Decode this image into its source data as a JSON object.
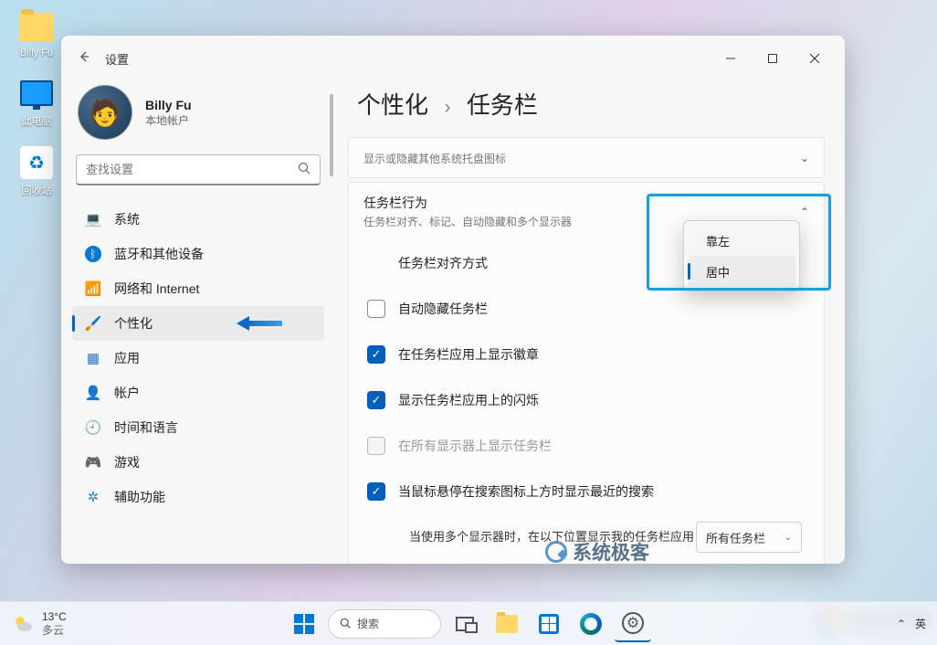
{
  "desktop": [
    {
      "name": "user-folder",
      "label": "Billy Fu"
    },
    {
      "name": "this-pc",
      "label": "此电脑"
    },
    {
      "name": "recycle-bin",
      "label": "回收站"
    }
  ],
  "window": {
    "title": "设置",
    "profile": {
      "name": "Billy Fu",
      "sub": "本地帐户"
    },
    "search_placeholder": "查找设置",
    "nav": [
      {
        "icon": "💻",
        "color": "#0078d4",
        "label": "系统",
        "name": "nav-system"
      },
      {
        "icon": "ᛒ",
        "color": "#0078d4",
        "label": "蓝牙和其他设备",
        "name": "nav-bluetooth",
        "iconbg": "#0078d4"
      },
      {
        "icon": "📶",
        "color": "#0aa0d8",
        "label": "网络和 Internet",
        "name": "nav-network"
      },
      {
        "icon": "🖌️",
        "color": "#d07030",
        "label": "个性化",
        "name": "nav-personalization",
        "active": true
      },
      {
        "icon": "▦",
        "color": "#3070c0",
        "label": "应用",
        "name": "nav-apps"
      },
      {
        "icon": "👤",
        "color": "#5a7a8a",
        "label": "帐户",
        "name": "nav-accounts"
      },
      {
        "icon": "🕘",
        "color": "#2090c0",
        "label": "时间和语言",
        "name": "nav-time-language"
      },
      {
        "icon": "🎮",
        "color": "#6a7a8a",
        "label": "游戏",
        "name": "nav-gaming"
      },
      {
        "icon": "✲",
        "color": "#1a90c8",
        "label": "辅助功能",
        "name": "nav-accessibility"
      }
    ],
    "breadcrumb": {
      "parent": "个性化",
      "current": "任务栏"
    },
    "tray_section": {
      "title": "",
      "sub": "显示或隐藏其他系统托盘图标"
    },
    "behavior_section": {
      "title": "任务栏行为",
      "sub": "任务栏对齐、标记、自动隐藏和多个显示器"
    },
    "align_row": {
      "label": "任务栏对齐方式",
      "options": [
        "靠左",
        "居中"
      ],
      "selected": "居中"
    },
    "rows": [
      {
        "type": "checkbox",
        "checked": false,
        "label": "自动隐藏任务栏",
        "name": "opt-auto-hide"
      },
      {
        "type": "checkbox",
        "checked": true,
        "label": "在任务栏应用上显示徽章",
        "name": "opt-badges"
      },
      {
        "type": "checkbox",
        "checked": true,
        "label": "显示任务栏应用上的闪烁",
        "name": "opt-flashing"
      },
      {
        "type": "checkbox",
        "checked": false,
        "disabled": true,
        "label": "在所有显示器上显示任务栏",
        "name": "opt-all-displays"
      },
      {
        "type": "checkbox",
        "checked": true,
        "label": "当鼠标悬停在搜索图标上方时显示最近的搜索",
        "name": "opt-recent-search"
      }
    ],
    "multi_display_row": {
      "label": "当使用多个显示器时，在以下位置显示我的任务栏应用",
      "select_value": "所有任务栏"
    }
  },
  "taskbar": {
    "weather": {
      "temp": "13°C",
      "desc": "多云"
    },
    "search_label": "搜索",
    "tray": {
      "lang": "英"
    }
  },
  "watermarks": {
    "wm1": "系统极客",
    "wm2": {
      "text": "纯净系统家园",
      "url": "www.yidaimei.com"
    }
  }
}
